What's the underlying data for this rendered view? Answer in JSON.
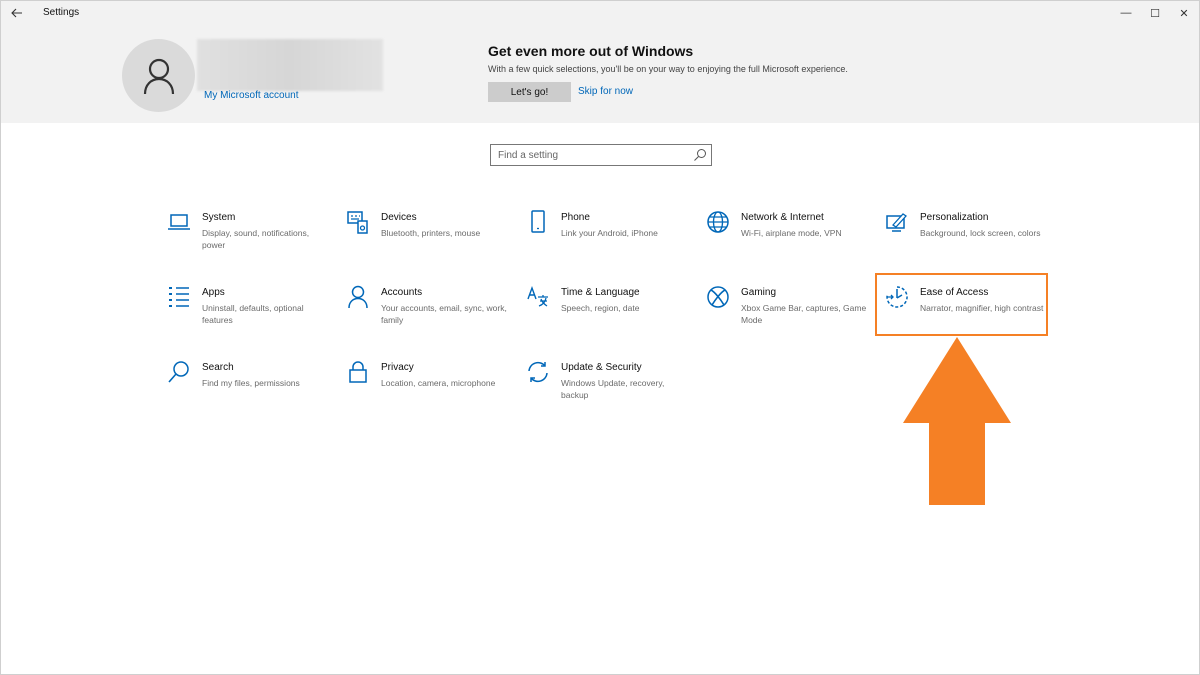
{
  "window": {
    "title": "Settings",
    "back_icon": "back-arrow-icon",
    "minimize": "—",
    "maximize": "☐",
    "close": "✕"
  },
  "banner": {
    "account_link": "My Microsoft account",
    "promo_title": "Get even more out of Windows",
    "promo_subtitle": "With a few quick selections, you'll be on your way to enjoying the full Microsoft experience.",
    "lets_go": "Let's go!",
    "skip": "Skip for now"
  },
  "search": {
    "placeholder": "Find a setting"
  },
  "tiles": [
    {
      "label": "System",
      "desc": "Display, sound, notifications, power",
      "icon": "laptop-icon"
    },
    {
      "label": "Devices",
      "desc": "Bluetooth, printers, mouse",
      "icon": "keyboard-speaker-icon"
    },
    {
      "label": "Phone",
      "desc": "Link your Android, iPhone",
      "icon": "phone-icon"
    },
    {
      "label": "Network & Internet",
      "desc": "Wi-Fi, airplane mode, VPN",
      "icon": "globe-icon"
    },
    {
      "label": "Personalization",
      "desc": "Background, lock screen, colors",
      "icon": "paint-brush-icon"
    },
    {
      "label": "Apps",
      "desc": "Uninstall, defaults, optional features",
      "icon": "apps-list-icon"
    },
    {
      "label": "Accounts",
      "desc": "Your accounts, email, sync, work, family",
      "icon": "person-icon"
    },
    {
      "label": "Time & Language",
      "desc": "Speech, region, date",
      "icon": "language-icon"
    },
    {
      "label": "Gaming",
      "desc": "Xbox Game Bar, captures, Game Mode",
      "icon": "xbox-icon"
    },
    {
      "label": "Ease of Access",
      "desc": "Narrator, magnifier, high contrast",
      "icon": "ease-of-access-icon"
    },
    {
      "label": "Search",
      "desc": "Find my files, permissions",
      "icon": "search-icon"
    },
    {
      "label": "Privacy",
      "desc": "Location, camera, microphone",
      "icon": "lock-icon"
    },
    {
      "label": "Update & Security",
      "desc": "Windows Update, recovery, backup",
      "icon": "sync-icon"
    }
  ],
  "colors": {
    "accent": "#0067b8",
    "highlight": "#f58025",
    "banner_bg": "#f2f2f2"
  }
}
